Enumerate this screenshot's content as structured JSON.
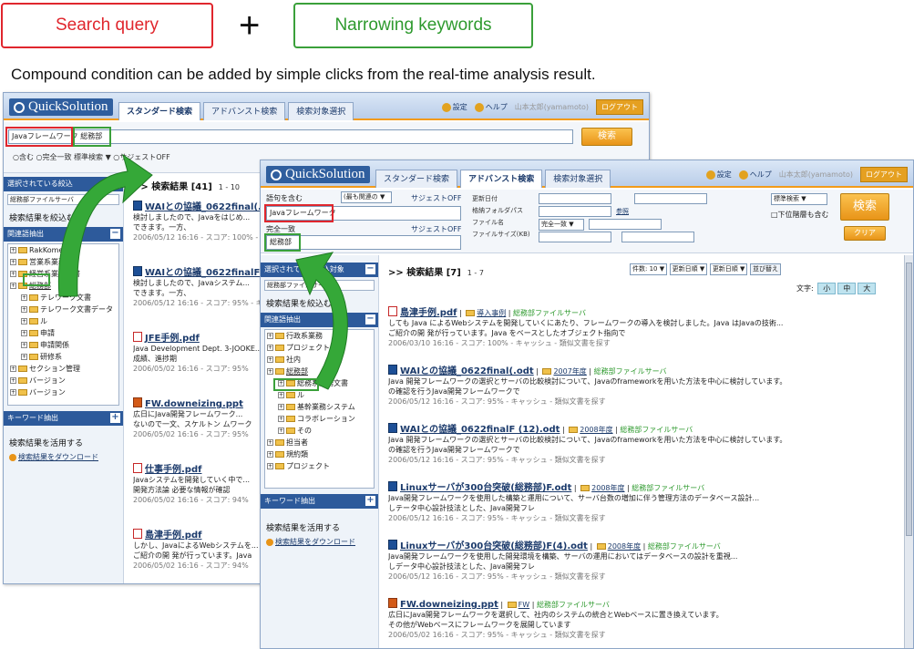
{
  "legend": {
    "search_query": "Search query",
    "plus": "+",
    "narrowing_keywords": "Narrowing keywords",
    "caption": "Compound condition can be added by simple clicks from the real-time analysis result."
  },
  "win1": {
    "logo": "QuickSolution",
    "tabs": [
      "スタンダード検索",
      "アドバンスト検索",
      "検索対象選択"
    ],
    "toplinks": {
      "settings": "設定",
      "help": "ヘルプ",
      "user": "山本太郎(yamamoto)",
      "logout": "ログアウト"
    },
    "query_text": "Javaフレームワーク 総務部",
    "search_button": "検索",
    "options": "○含む ○完全一致 標準検索 ▼  ○サジェストOFF",
    "sidebar": {
      "selected_head": "選択されている絞込",
      "selected_value": "総務部ファイルサーバ",
      "narrow_title": "検索結果を絞込む",
      "related_head": "関連語抽出",
      "tree": [
        "RakKomext",
        "営業系業務",
        "経営系業務文書",
        "総務部",
        "テレワーク文書",
        "テレワーク文書データ",
        "ル",
        "申請",
        "申請関係",
        "研修系",
        "セクション管理",
        "バージョン",
        "バージョン"
      ],
      "keyword_head": "キーワード抽出",
      "use_title": "検索結果を活用する",
      "download": "検索結果をダウンロード"
    },
    "results_head": ">> 検索結果 [41]",
    "pager": "1 - 10",
    "results": [
      {
        "title": "WAIとの協議_0622final(.odt)",
        "snippet": "検討しましたので、Javaをはじめ...",
        "snippet2": "できます。一方、",
        "meta": "2006/05/12 16:16 - スコア: 100% - キャッシュ"
      },
      {
        "title": "WAIとの協議_0622finalF (2).odt",
        "snippet": "検討しましたので、Javaシステム...",
        "snippet2": "できます。一方、",
        "meta": "2006/05/12 16:16 - スコア: 95% - キャッシュ"
      },
      {
        "title": "JFE手例.pdf",
        "snippet": "Java Development Dept. 3-JOOKE...",
        "snippet2": "成績、進捗期",
        "meta": "2006/05/02 16:16 - スコア: 95%"
      },
      {
        "title": "FW.downeizing.ppt",
        "snippet": "広日にJava開発フレームワーク...",
        "snippet2": "ないので一文、スケルトン ムワーク",
        "meta": "2006/05/02 16:16 - スコア: 95%"
      },
      {
        "title": "仕事手例.pdf",
        "snippet": "Javaシステムを開発していく中で...",
        "snippet2": "開発方法論 必要な情報が確認",
        "meta": "2006/05/02 16:16 - スコア: 94%"
      },
      {
        "title": "島津手例.pdf",
        "snippet": "しかし、JavaによるWebシステムを...",
        "snippet2": "ご紹介の開 発が行っています。Java",
        "meta": "2006/05/02 16:16 - スコア: 94%"
      }
    ]
  },
  "win2": {
    "logo": "QuickSolution",
    "tabs": [
      "スタンダード検索",
      "アドバンスト検索",
      "検索対象選択"
    ],
    "toplinks": {
      "settings": "設定",
      "help": "ヘルプ",
      "user": "山本太郎(yamamoto)",
      "logout": "ログアウト"
    },
    "label_any": "語句を含む",
    "label_exact": "完全一致",
    "mode_select": "(最も関連の ▼",
    "suggest_off": "サジェストOFF",
    "query_text": "Javaフレームワーク",
    "narrow_text": "総務部",
    "adv_labels": [
      "更新日付",
      "格納フォルダパス",
      "ファイル名",
      "ファイルサイズ(KB)"
    ],
    "adv_select": "完全一致 ▼",
    "mode_right": "標準検索 ▼",
    "include_sub": "□下位階層も含む",
    "detail_link": "参照",
    "search_button": "検索",
    "clear_button": "クリア",
    "sidebar": {
      "selected_head": "選択されている絞込対象",
      "selected_value": "総務部ファイルサーバ",
      "narrow_title": "検索結果を絞込む",
      "related_head": "関連語抽出",
      "tree": [
        "行政系業務",
        "プロジェクト",
        "社内",
        "総務部",
        "総務系業務文書",
        "ル",
        "基幹業務システム",
        "コラボレーション",
        "その",
        "担当者",
        "規約類",
        "プロジェクト"
      ],
      "keyword_head": "キーワード抽出",
      "use_title": "検索結果を活用する",
      "download": "検索結果をダウンロード"
    },
    "results_head": ">> 検索結果 [7]",
    "pager": "1 - 7",
    "display_count": "件数: 10 ▼",
    "sort1": "更新日順 ▼",
    "sort2": "更新日順 ▼",
    "reorder": "並び替え",
    "fontsize_label": "文字:",
    "fontsizes": [
      "小",
      "中",
      "大"
    ],
    "results": [
      {
        "title": "島津手例.pdf",
        "folder": "導入事例",
        "src": "総務部ファイルサーバ",
        "snippet": "しても Java によるWebシステムを開発していくにあたり、フレームワークの導入を検討しました。Java はJavaの技術...",
        "snippet2": "ご紹介の開 発が行っています。Java をベースとしたオブジェクト指向で",
        "meta": "2006/03/10 16:16 - スコア: 100% - キャッシュ - 類似文書を探す",
        "type": "pdf"
      },
      {
        "title": "WAIとの協議_0622final(.odt",
        "folder": "2007年度",
        "src": "総務部ファイルサーバ",
        "snippet": "Java 開発フレームワークの選択とサーバの比較検討について、Javaのframeworkを用いた方法を中心に検討しています。",
        "snippet2": "の確認を行うJava開発フレームワークで",
        "meta": "2006/05/12 16:16 - スコア: 95% - キャッシュ - 類似文書を探す",
        "type": "doc"
      },
      {
        "title": "WAIとの協議_0622finalF (12).odt",
        "folder": "2008年度",
        "src": "総務部ファイルサーバ",
        "snippet": "Java 開発フレームワークの選択とサーバの比較検討について、Javaのframeworkを用いた方法を中心に検討しています。",
        "snippet2": "の確認を行うJava開発フレームワークで",
        "meta": "2006/05/12 16:16 - スコア: 95% - キャッシュ - 類似文書を探す",
        "type": "doc"
      },
      {
        "title": "Linuxサーバが300台突破(総務部)F.odt",
        "folder": "2008年度",
        "src": "総務部ファイルサーバ",
        "snippet": "Java開発フレームワークを使用した構築と運用について、サーバ台数の増加に伴う管理方法のデータベース設計...",
        "snippet2": "しテータ中心設計技法とした、Java開発フレ",
        "meta": "2006/05/12 16:16 - スコア: 95% - キャッシュ - 類似文書を探す",
        "type": "doc"
      },
      {
        "title": "Linuxサーバが300台突破(総務部)F(4).odt",
        "folder": "2008年度",
        "src": "総務部ファイルサーバ",
        "snippet": "Java開発フレームワークを使用した開発環境を構築、サーバの運用においてはデータベースの設計を重視...",
        "snippet2": "しデータ中心設計技法とした、Java開発フレ",
        "meta": "2006/05/12 16:16 - スコア: 95% - キャッシュ - 類似文書を探す",
        "type": "doc"
      },
      {
        "title": "FW.downeizing.ppt",
        "folder": "FW",
        "src": "総務部ファイルサーバ",
        "snippet": "広日にJava開発フレームワークを選択して、社内のシステムの統合とWebベースに置き換えています。",
        "snippet2": "その他がWebベースにフレームワークを展開しています",
        "meta": "2006/05/02 16:16 - スコア: 95% - キャッシュ - 類似文書を探す",
        "type": "ppt"
      }
    ]
  },
  "colors": {
    "red": "#e0262d",
    "green": "#3aa03a",
    "orange": "#f29b1a",
    "navy": "#2d5a9b"
  }
}
